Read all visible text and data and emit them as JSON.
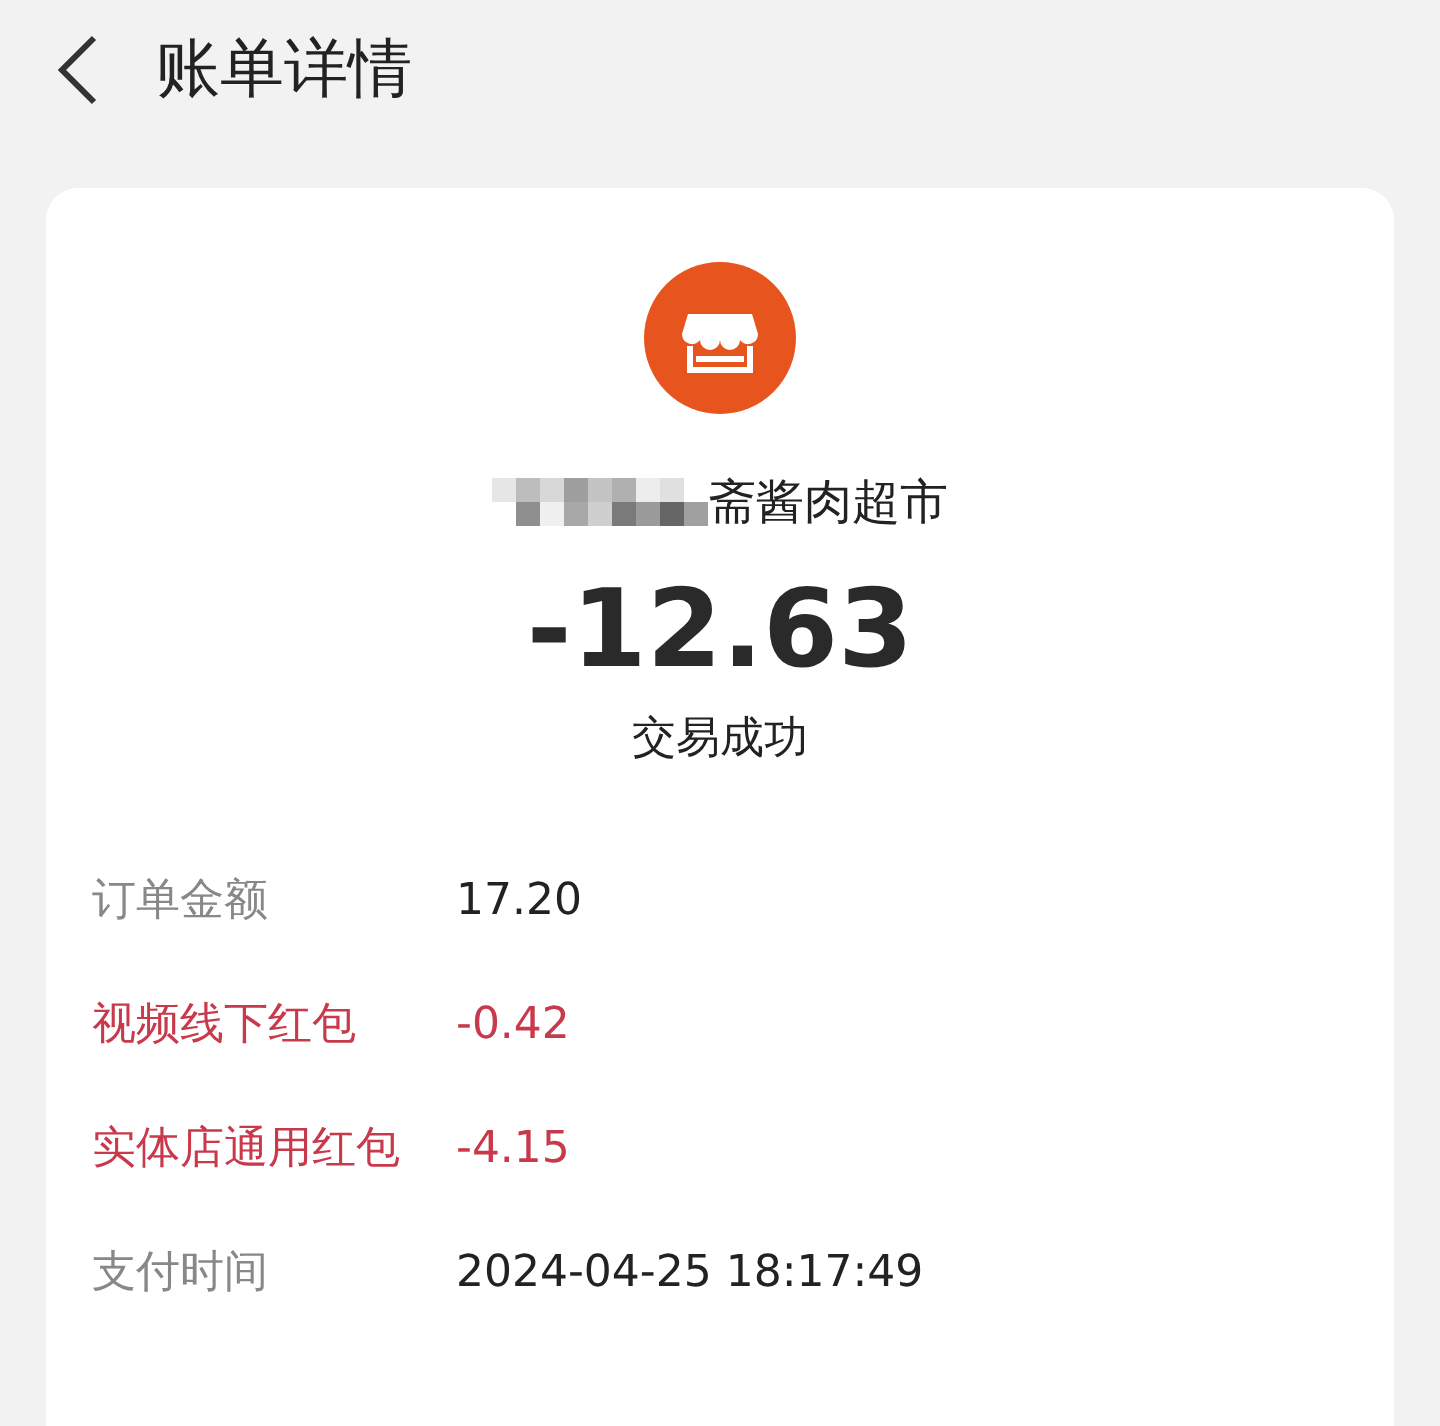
{
  "header": {
    "title": "账单详情"
  },
  "merchant": {
    "name": "斋酱肉超市"
  },
  "amount": "-12.63",
  "status": "交易成功",
  "details": [
    {
      "label": "订单金额",
      "value": "17.20",
      "kind": "normal"
    },
    {
      "label": "视频线下红包",
      "value": "-0.42",
      "kind": "discount"
    },
    {
      "label": "实体店通用红包",
      "value": "-4.15",
      "kind": "discount"
    },
    {
      "label": "支付时间",
      "value": "2024-04-25 18:17:49",
      "kind": "normal"
    }
  ]
}
